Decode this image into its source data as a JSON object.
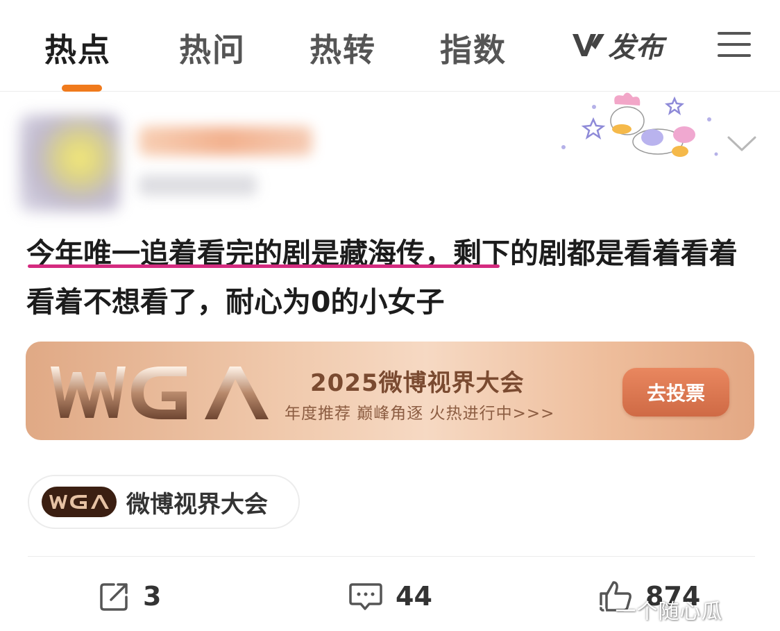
{
  "tabs": [
    {
      "label": "热点",
      "active": true
    },
    {
      "label": "热问",
      "active": false
    },
    {
      "label": "热转",
      "active": false
    },
    {
      "label": "指数",
      "active": false
    }
  ],
  "publish": {
    "label": "发布",
    "icon": "v-logo-icon"
  },
  "menu": {
    "icon": "hamburger-menu-icon"
  },
  "colors": {
    "accent": "#f07a1c",
    "underline": "#d42b7f",
    "banner_button": "#d9774f",
    "text": "#1c1c1c"
  },
  "post": {
    "underlined_text": "今年唯一追着看完的剧是藏海传，",
    "rest_text": "剩下的剧都是看着看着看着不想看了，耐心为0的小女子"
  },
  "banner": {
    "logo_text": "WGA",
    "title": "2025微博视界大会",
    "subtitle": "年度推荐 巅峰角逐 火热进行中>>>",
    "button": "去投票"
  },
  "topic": {
    "logo_text": "WGA",
    "label": "微博视界大会"
  },
  "actions": {
    "repost_count": "3",
    "comment_count": "44",
    "like_count": "874"
  },
  "watermark": "一个随心瓜"
}
